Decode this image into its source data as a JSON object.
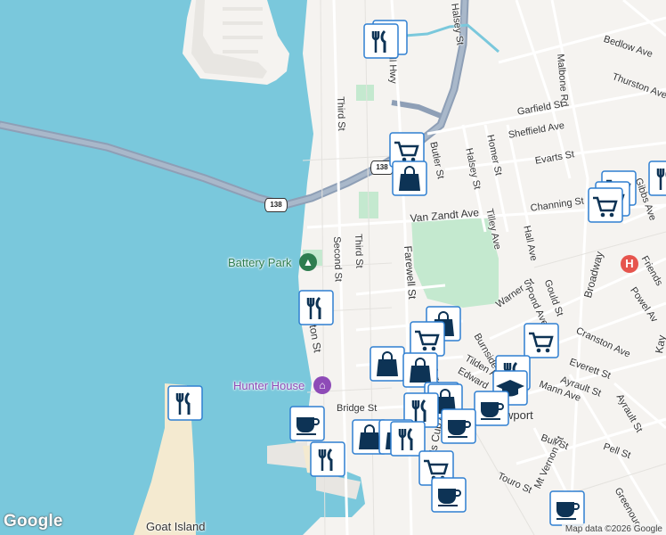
{
  "map": {
    "streets": [
      {
        "key": "bedlow",
        "text": "Bedlow Ave"
      },
      {
        "key": "thurston",
        "text": "Thurston Ave"
      },
      {
        "key": "malbone",
        "text": "Malbone Rd"
      },
      {
        "key": "halsey_st",
        "text": "Halsey St"
      },
      {
        "key": "third_n",
        "text": "Third St"
      },
      {
        "key": "garfield",
        "text": "Garfield St"
      },
      {
        "key": "sheffield",
        "text": "Sheffield Ave"
      },
      {
        "key": "evarts",
        "text": "Evarts St"
      },
      {
        "key": "butler",
        "text": "Butler St"
      },
      {
        "key": "halsey_st2",
        "text": "Halsey St"
      },
      {
        "key": "homer",
        "text": "Homer St"
      },
      {
        "key": "tilley",
        "text": "Tilley Ave"
      },
      {
        "key": "vanzandt",
        "text": "Van Zandt Ave"
      },
      {
        "key": "channing",
        "text": "Channing St"
      },
      {
        "key": "gibbs",
        "text": "Gibbs Ave"
      },
      {
        "key": "hall",
        "text": "Hall Ave"
      },
      {
        "key": "second",
        "text": "Second St"
      },
      {
        "key": "third_s",
        "text": "Third St"
      },
      {
        "key": "farewell",
        "text": "Farewell St"
      },
      {
        "key": "warner",
        "text": "Warner St"
      },
      {
        "key": "broadway",
        "text": "Broadway"
      },
      {
        "key": "gould",
        "text": "Gould St"
      },
      {
        "key": "pond",
        "text": "Pond Ave"
      },
      {
        "key": "friends",
        "text": "Friends"
      },
      {
        "key": "powel",
        "text": "Powel Av"
      },
      {
        "key": "cranston",
        "text": "Cranston Ave"
      },
      {
        "key": "kay",
        "text": "Kay"
      },
      {
        "key": "washington",
        "text": "ngton St"
      },
      {
        "key": "burnside",
        "text": "Burnside"
      },
      {
        "key": "tilden",
        "text": "Tilden Ave"
      },
      {
        "key": "edward",
        "text": "Edward"
      },
      {
        "key": "farewell2",
        "text": "Farewell"
      },
      {
        "key": "everett",
        "text": "Everett St"
      },
      {
        "key": "ayrault",
        "text": "Ayrault St"
      },
      {
        "key": "mann",
        "text": "Mann Ave"
      },
      {
        "key": "ayrault2",
        "text": "Ayrault St"
      },
      {
        "key": "bridge",
        "text": "Bridge St"
      },
      {
        "key": "bull",
        "text": "Bull St"
      },
      {
        "key": "pell",
        "text": "Pell St"
      },
      {
        "key": "mtvernon",
        "text": "Mt Vernon St"
      },
      {
        "key": "touro",
        "text": "Touro St"
      },
      {
        "key": "greenough",
        "text": "Greenoug"
      },
      {
        "key": "americas",
        "text": "rica's Cup Ave"
      },
      {
        "key": "newport",
        "text": "wport"
      },
      {
        "key": "hwy",
        "text": "hell Hwy"
      }
    ],
    "route_shield": "138",
    "pois": {
      "battery_park": "Battery Park",
      "hunter_house": "Hunter House",
      "goat_island": "Goat Island"
    },
    "hospital_symbol": "H",
    "attribution": "Map data ©2026 Google",
    "logo": "Google",
    "colors": {
      "water": "#7ac8dc",
      "land": "#f5f3f0",
      "park": "#c4e9cf",
      "highway": "#8e9fb6",
      "sand": "#f4ead0",
      "marker_fill": "#ffffff",
      "marker_border": "#2f7fd1",
      "marker_icon": "#0d3355",
      "poi_green": "#2e7d4f",
      "poi_purple": "#8e4bb7",
      "hospital": "#e6544d"
    },
    "markers": [
      {
        "key": "m1",
        "icon": "restaurant-icon"
      },
      {
        "key": "m2",
        "icon": "restaurant-icon"
      },
      {
        "key": "m3",
        "icon": "shopping-cart-icon"
      },
      {
        "key": "m4",
        "icon": "shopping-bag-icon"
      },
      {
        "key": "m5",
        "icon": "shopping-cart-icon"
      },
      {
        "key": "m6",
        "icon": "shopping-cart-icon"
      },
      {
        "key": "m7",
        "icon": "shopping-cart-icon"
      },
      {
        "key": "m8",
        "icon": "restaurant-icon"
      },
      {
        "key": "m9",
        "icon": "shopping-bag-icon"
      },
      {
        "key": "m10",
        "icon": "shopping-cart-icon"
      },
      {
        "key": "m11",
        "icon": "shopping-cart-icon"
      },
      {
        "key": "m12",
        "icon": "shopping-bag-icon"
      },
      {
        "key": "m13",
        "icon": "shopping-bag-icon"
      },
      {
        "key": "m14",
        "icon": "restaurant-icon"
      },
      {
        "key": "m15",
        "icon": "school-icon"
      },
      {
        "key": "m16",
        "icon": "restaurant-icon"
      },
      {
        "key": "m17",
        "icon": "restaurant-icon"
      },
      {
        "key": "m18",
        "icon": "shopping-bag-icon"
      },
      {
        "key": "m19",
        "icon": "coffee-icon"
      },
      {
        "key": "m20",
        "icon": "coffee-icon"
      },
      {
        "key": "m21",
        "icon": "coffee-icon"
      },
      {
        "key": "m22",
        "icon": "restaurant-icon"
      },
      {
        "key": "m23",
        "icon": "shopping-bag-icon"
      },
      {
        "key": "m24",
        "icon": "shopping-bag-icon"
      },
      {
        "key": "m25",
        "icon": "restaurant-icon"
      },
      {
        "key": "m26",
        "icon": "shopping-cart-icon"
      },
      {
        "key": "m27",
        "icon": "coffee-icon"
      },
      {
        "key": "m28",
        "icon": "coffee-icon"
      },
      {
        "key": "m29",
        "icon": "restaurant-icon"
      },
      {
        "key": "m30",
        "icon": "restaurant-icon"
      }
    ]
  }
}
